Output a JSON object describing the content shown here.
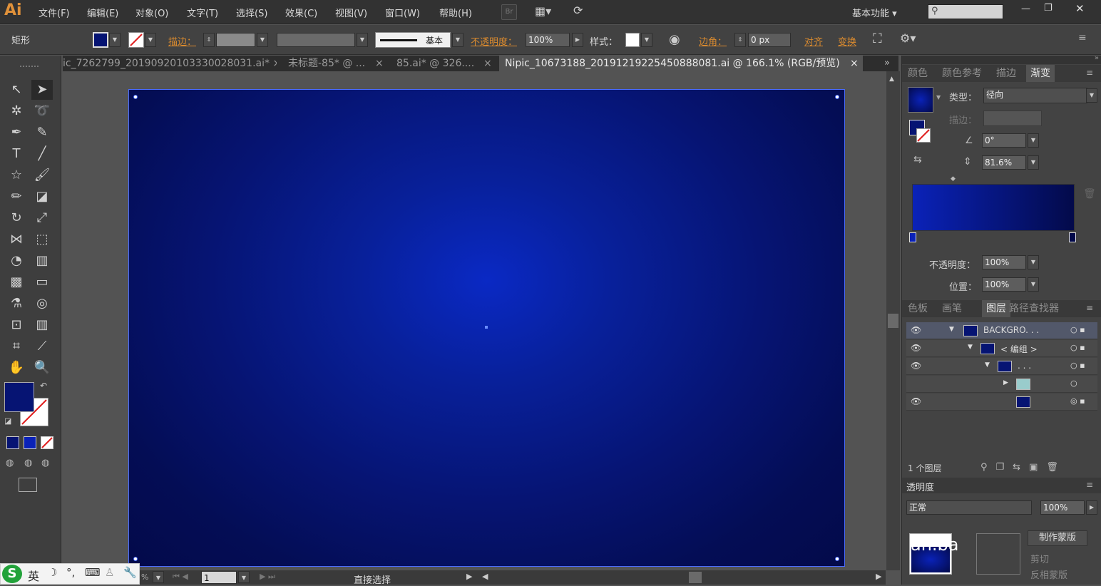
{
  "app": {
    "logo": "Ai",
    "workspace": "基本功能"
  },
  "menu": [
    "文件(F)",
    "编辑(E)",
    "对象(O)",
    "文字(T)",
    "选择(S)",
    "效果(C)",
    "视图(V)",
    "窗口(W)",
    "帮助(H)"
  ],
  "menu_br": "Br",
  "window_controls": {
    "minimize": "—",
    "restore": "❐",
    "close": "✕"
  },
  "control": {
    "object_type": "矩形",
    "stroke_label": "描边：",
    "stroke_style": "基本",
    "opacity_label": "不透明度：",
    "opacity_value": "100%",
    "style_label": "样式：",
    "corner_label": "边角：",
    "corner_value": "0 px",
    "align_label": "对齐",
    "transform_label": "变换"
  },
  "tabs": [
    {
      "label": "ic_7262799_20190920103330028031.ai*",
      "close": "×"
    },
    {
      "label": "未标题-85* @ ...",
      "close": "×"
    },
    {
      "label": "85.ai* @ 326....",
      "close": "×"
    },
    {
      "label": "Nipic_10673188_20191219225450888081.ai @ 166.1% (RGB/预览)",
      "close": "×"
    }
  ],
  "status": {
    "zoom_suffix": "%",
    "page": "1",
    "tool_name": "直接选择"
  },
  "gradient_panel": {
    "tabs": [
      "颜色",
      "颜色参考",
      "描边",
      "渐变"
    ],
    "type_label": "类型：",
    "type_value": "径向",
    "stroke_label": "描边：",
    "angle_value": "0°",
    "aspect_value": "81.6%",
    "opacity_label": "不透明度：",
    "opacity_value": "100%",
    "location_label": "位置：",
    "location_value": "100%",
    "colors": {
      "stop_left": "#0a22b8",
      "stop_right": "#030a4a"
    }
  },
  "layers_panel": {
    "tabs": [
      "色板",
      "画笔",
      "图层",
      "路径查找器"
    ],
    "rows": [
      {
        "name": "BACKGRO. . ."
      },
      {
        "name": "< 编组 >"
      },
      {
        "name": ". . ."
      },
      {
        "name": ""
      },
      {
        "name": ""
      }
    ],
    "footer": "1 个图层"
  },
  "transparency_panel": {
    "title": "透明度",
    "mode": "正常",
    "opacity": "100%",
    "make_mask": "制作蒙版",
    "clip": "剪切",
    "invert": "反相蒙版"
  },
  "watermark": "an.ba",
  "ime": {
    "lang": "英"
  }
}
